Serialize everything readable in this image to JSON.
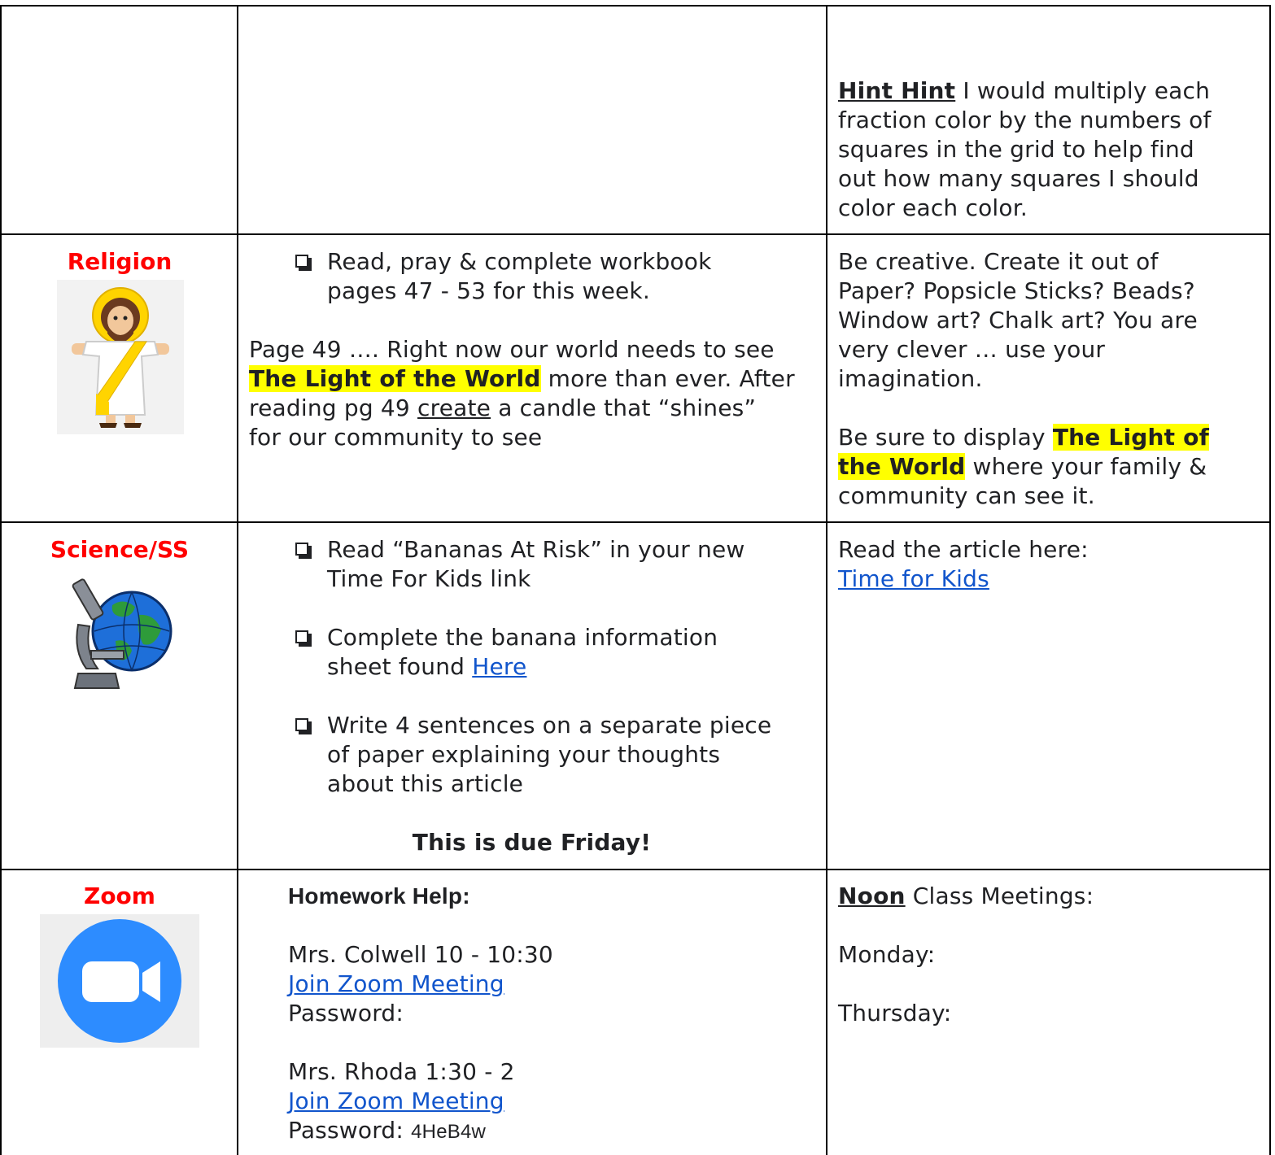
{
  "hint_cell": {
    "label": "Hint Hint",
    "line1_rest": " I would multiply each",
    "line2": "fraction color by the numbers of",
    "line3": "squares in the grid to help find",
    "line4": "out how many squares I should",
    "line5": "color each color."
  },
  "religion": {
    "subject": "Religion",
    "icon": "jesus-figure-icon",
    "task_line1": "Read, pray & complete workbook",
    "task_line2": "pages 47 - 53 for this week.",
    "para_line1": "Page 49 …. Right now our world needs to see",
    "para_highlight": "The Light of the World",
    "para_line2_rest": " more than ever.  After",
    "para_line3_start": "reading pg 49 ",
    "para_create": "create",
    "para_line3_rest": " a candle that “shines”",
    "para_line4": "for our community to see",
    "notes_line1": "Be creative.  Create it out of",
    "notes_line2": "Paper? Popsicle Sticks? Beads?",
    "notes_line3": "Window art? Chalk art? You are",
    "notes_line4": "very clever … use your",
    "notes_line5": "imagination.",
    "display_line1_start": "Be sure to display ",
    "display_hl1": "The Light of",
    "display_hl2": "the World",
    "display_line2_rest": " where your family &",
    "display_line3": "community can see it."
  },
  "science": {
    "subject": "Science/SS",
    "icon": "microscope-globe-icon",
    "task1_line1": "Read “Bananas At Risk” in your new",
    "task1_line2": "Time For Kids link",
    "task2_line1": "Complete the banana information",
    "task2_line2_start": "sheet found ",
    "task2_link": "Here",
    "task3_line1": "Write 4 sentences on a separate piece",
    "task3_line2": "of paper explaining your thoughts",
    "task3_line3": "about this article",
    "due": "This is due Friday!",
    "notes_line1": "Read the article here:",
    "notes_link": "Time for Kids"
  },
  "zoom": {
    "subject": "Zoom",
    "icon": "zoom-camera-icon",
    "help_title": "Homework Help:",
    "teacher1": "Mrs. Colwell 10 - 10:30",
    "join_link1": "Join Zoom Meeting",
    "password1_label": "Password:",
    "teacher2": "Mrs. Rhoda 1:30 - 2",
    "join_link2": "Join Zoom Meeting",
    "password2_label": "Password: ",
    "password2_value": "4HeB4w",
    "noon_label": "Noon",
    "noon_rest": " Class Meetings:",
    "monday": "Monday:",
    "thursday": "Thursday:"
  },
  "colors": {
    "subject_red": "#ff0000",
    "link_blue": "#1155cc",
    "highlight_yellow": "#ffff00",
    "zoom_blue": "#2d8cff"
  }
}
